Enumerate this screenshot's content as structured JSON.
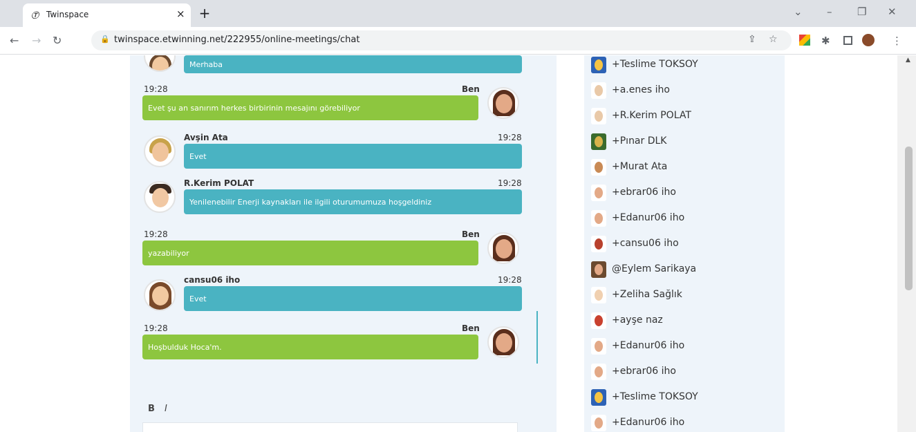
{
  "browser": {
    "tab_title": "Twinspace",
    "tab_icon": "Ⓣ",
    "close_tab": "×",
    "new_tab": "+",
    "url": "twinspace.etwinning.net/222955/online-meetings/chat",
    "window_controls": [
      "⌄",
      "–",
      "❐",
      "✕"
    ]
  },
  "chat": {
    "messages": [
      {
        "kind": "in",
        "sender": "",
        "time": "",
        "text": "Merhaba"
      },
      {
        "kind": "out",
        "sender": "Ben",
        "time": "19:28",
        "text": "Evet şu an sanırım herkes birbirinin mesajını görebiliyor"
      },
      {
        "kind": "in",
        "sender": "Avşin Ata",
        "time": "19:28",
        "text": "Evet"
      },
      {
        "kind": "in",
        "sender": "R.Kerim POLAT",
        "time": "19:28",
        "text": "Yenilenebilir Enerji kaynakları ile ilgili oturumumuza hoşgeldiniz"
      },
      {
        "kind": "out",
        "sender": "Ben",
        "time": "19:28",
        "text": "yazabiliyor"
      },
      {
        "kind": "in",
        "sender": "cansu06 iho",
        "time": "19:28",
        "text": "Evet"
      },
      {
        "kind": "out",
        "sender": "Ben",
        "time": "19:28",
        "text": "Hoşbulduk Hoca'm."
      }
    ],
    "format_bold": "B",
    "format_italic": "I"
  },
  "participants": [
    "+Teslime TOKSOY",
    "+a.enes iho",
    "+R.Kerim POLAT",
    "+Pınar DLK",
    "+Murat Ata",
    "+ebrar06 iho",
    "+Edanur06 iho",
    "+cansu06 iho",
    "@Eylem Sarikaya",
    "+Zeliha Sağlık",
    "+ayşe naz",
    "+Edanur06 iho",
    "+ebrar06 iho",
    "+Teslime TOKSOY",
    "+Edanur06 iho"
  ],
  "colors": {
    "incoming": "#4ab3c2",
    "outgoing": "#8dc63f",
    "panel": "#eef4fa"
  }
}
